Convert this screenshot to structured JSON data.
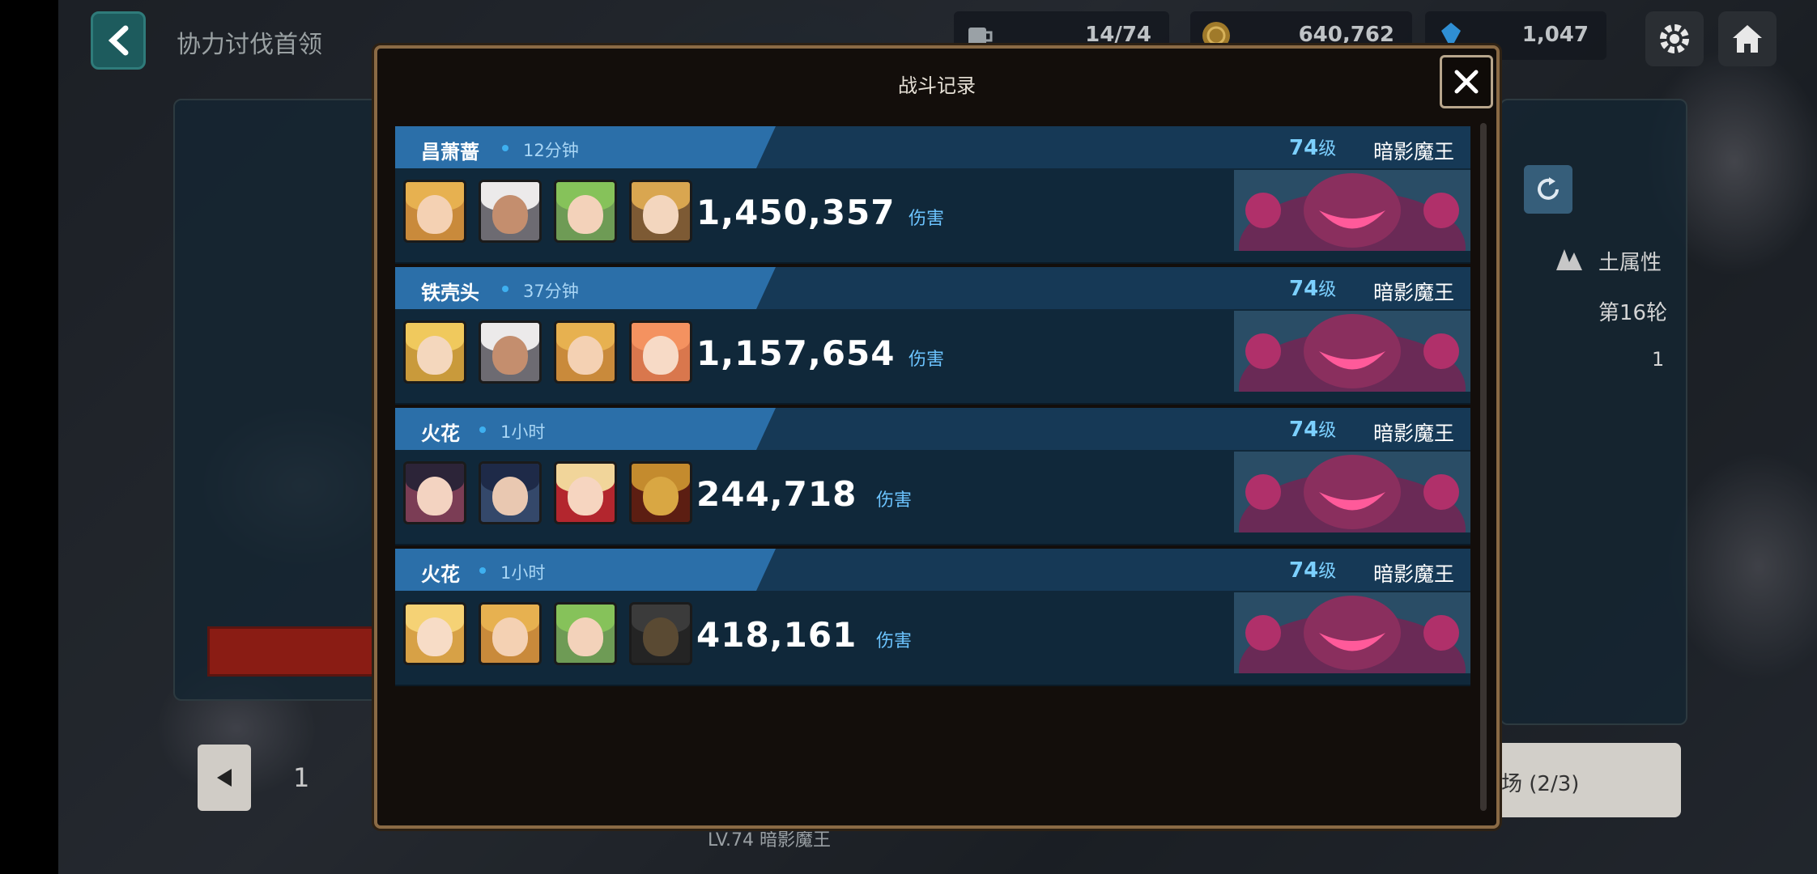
{
  "header": {
    "title": "协力讨伐首领",
    "resources": [
      {
        "icon": "coffee-icon",
        "value": "14/74"
      },
      {
        "icon": "gold-coin-icon",
        "value": "640,762"
      },
      {
        "icon": "gem-icon",
        "value": "1,047"
      }
    ]
  },
  "background": {
    "element": "土属性",
    "round": "第16轮",
    "count": "1",
    "page": "1",
    "enter_label": "场 (2/3)",
    "footer": "LV.74 暗影魔王"
  },
  "modal": {
    "title": "战斗记录",
    "records": [
      {
        "player": "昌萧蔷",
        "time": "12分钟",
        "level": "74",
        "level_suffix": "级",
        "boss": "暗影魔王",
        "damage": "1,450,357",
        "damage_label": "伤害"
      },
      {
        "player": "铁壳头",
        "time": "37分钟",
        "level": "74",
        "level_suffix": "级",
        "boss": "暗影魔王",
        "damage": "1,157,654",
        "damage_label": "伤害"
      },
      {
        "player": "火花",
        "time": "1小时",
        "level": "74",
        "level_suffix": "级",
        "boss": "暗影魔王",
        "damage": "244,718",
        "damage_label": "伤害"
      },
      {
        "player": "火花",
        "time": "1小时",
        "level": "74",
        "level_suffix": "级",
        "boss": "暗影魔王",
        "damage": "418,161",
        "damage_label": "伤害"
      }
    ]
  },
  "colors": {
    "accent": "#2b6fa9",
    "level": "#7cd0ff",
    "damage_label": "#6cc4ff",
    "frame": "#8a6a45"
  }
}
